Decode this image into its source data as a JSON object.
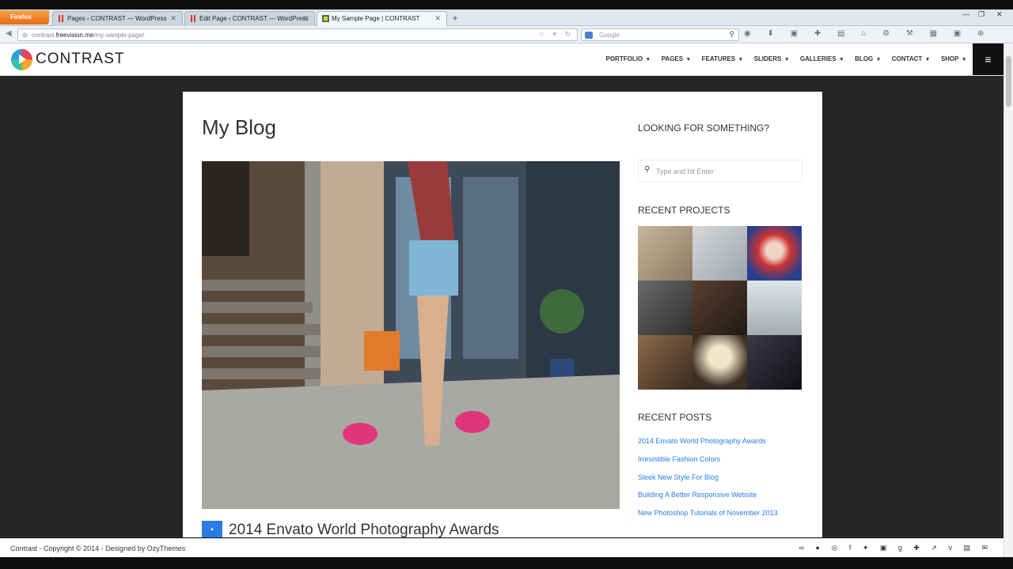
{
  "browser": {
    "menu_button": "Firefox",
    "tabs": [
      {
        "label": "Pages ‹ CONTRAST — WordPress",
        "active": false
      },
      {
        "label": "Edit Page ‹ CONTRAST — WordPress",
        "active": false
      },
      {
        "label": "My Sample Page | CONTRAST",
        "active": true
      }
    ],
    "url_prefix": "contrast.",
    "url_host": "freevision.me",
    "url_path": "/my-sample-page/",
    "search_placeholder": "Google"
  },
  "site": {
    "logo": "CONTRAST",
    "nav": [
      "PORTFOLIO",
      "PAGES",
      "FEATURES",
      "SLIDERS",
      "GALLERIES",
      "BLOG",
      "CONTACT",
      "SHOP"
    ]
  },
  "page": {
    "title": "My Blog",
    "post_title": "2014 Envato World Photography Awards"
  },
  "sidebar": {
    "search_title": "LOOKING FOR SOMETHING?",
    "search_placeholder": "Type and hit Enter",
    "projects_title": "RECENT PROJECTS",
    "posts_title": "RECENT POSTS",
    "recent_posts": [
      "2014 Envato World Photography Awards",
      "Irresistible Fashion Colors",
      "Sleek New Style For Blog",
      "Building A Better Responsive Website",
      "New Photoshop Tutorials of November 2013"
    ]
  },
  "footer": {
    "text": "Contrast - Copyright © 2014 - Designed by OzyThemes"
  },
  "colors": {
    "accent": "#2b7be4",
    "page_background": "#262626"
  }
}
